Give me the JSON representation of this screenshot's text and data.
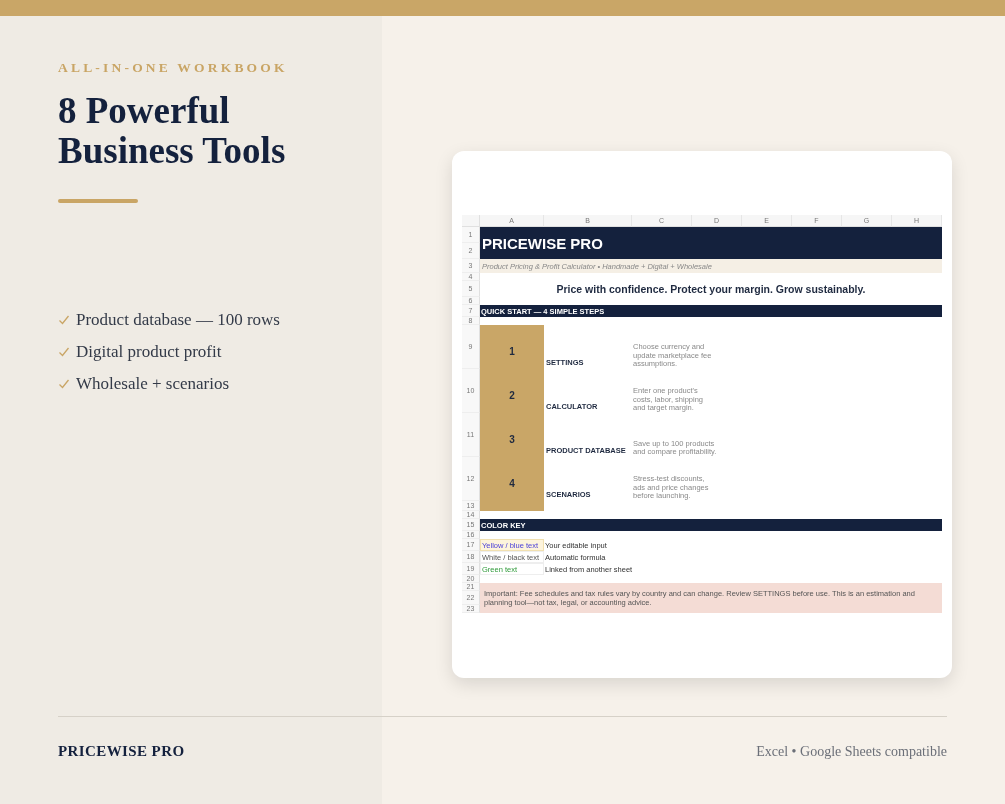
{
  "eyebrow": "ALL-IN-ONE WORKBOOK",
  "headline": "8 Powerful Business Tools",
  "features": [
    "Product database — 100 rows",
    "Digital product profit",
    "Wholesale + scenarios"
  ],
  "sheet": {
    "columns": [
      "A",
      "B",
      "C",
      "D",
      "E",
      "F",
      "G",
      "H"
    ],
    "row_numbers": [
      "1",
      "2",
      "3",
      "4",
      "5",
      "6",
      "7",
      "8",
      "9",
      "10",
      "11",
      "12",
      "13",
      "14",
      "15",
      "16",
      "17",
      "18",
      "19",
      "20",
      "21",
      "22",
      "23"
    ],
    "title": "PRICEWISE PRO",
    "subtitle": "Product Pricing & Profit Calculator • Handmade + Digital + Wholesale",
    "tagline": "Price with confidence. Protect your margin. Grow sustainably.",
    "quick_start_heading": "QUICK START — 4 SIMPLE STEPS",
    "steps": [
      {
        "number": "1",
        "name": "SETTINGS",
        "description": "Choose currency and update marketplace fee assumptions."
      },
      {
        "number": "2",
        "name": "CALCULATOR",
        "description": "Enter one product's costs, labor, shipping and target margin."
      },
      {
        "number": "3",
        "name": "PRODUCT DATABASE",
        "description": "Save up to 100 products and compare profitability."
      },
      {
        "number": "4",
        "name": "SCENARIOS",
        "description": "Stress-test discounts, ads and price changes before launching."
      }
    ],
    "color_key_heading": "COLOR KEY",
    "color_key": [
      {
        "kind": "input",
        "sample": "Yellow / blue text",
        "meaning": "Your editable input"
      },
      {
        "kind": "formula",
        "sample": "White / black text",
        "meaning": "Automatic formula"
      },
      {
        "kind": "linked",
        "sample": "Green text",
        "meaning": "Linked from another sheet"
      }
    ],
    "notice": "Important: Fee schedules and tax rules vary by country and can change. Review SETTINGS before use. This is an estimation and planning tool—not tax, legal, or accounting advice."
  },
  "footer": {
    "brand": "PRICEWISE PRO",
    "compatibility": "Excel • Google Sheets compatible"
  }
}
